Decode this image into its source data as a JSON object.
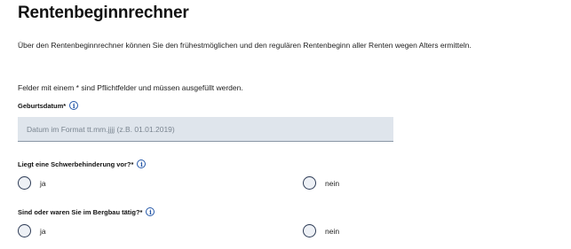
{
  "page": {
    "title": "Rentenbeginnrechner",
    "intro": "Über den Rentenbeginnrechner können Sie den frühestmöglichen und den regulären Rentenbeginn aller Renten wegen Alters ermitteln.",
    "required_note": "Felder mit einem * sind Pflichtfelder und müssen ausgefüllt werden."
  },
  "birthdate": {
    "label": "Geburtsdatum*",
    "placeholder": "Datum im Format tt.mm.jjjj (z.B. 01.01.2019)",
    "value": ""
  },
  "disability": {
    "label": "Liegt eine Schwerbehinderung vor?*",
    "options": [
      "ja",
      "nein"
    ],
    "selected": null
  },
  "mining": {
    "label": "Sind oder waren Sie im Bergbau tätig?*",
    "options": [
      "ja",
      "nein"
    ],
    "selected": null
  },
  "icons": {
    "info": "info-icon",
    "info_glyph": "i"
  },
  "colors": {
    "accent": "#2457a8",
    "input_bg": "#dfe5ec",
    "radio_border": "#2d3b55"
  }
}
